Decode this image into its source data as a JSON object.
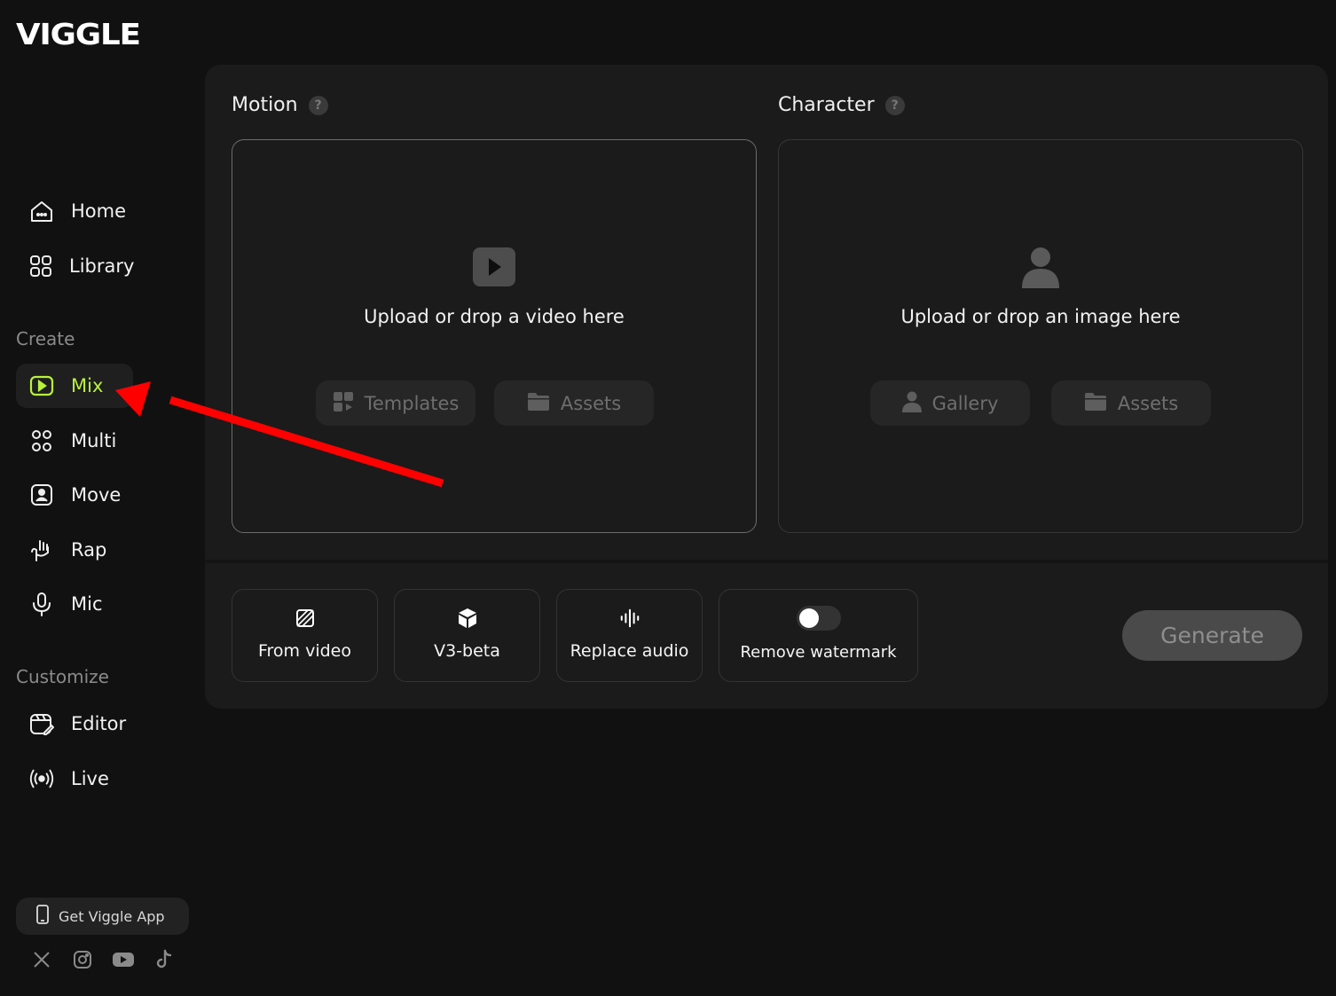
{
  "brand": {
    "logo_text": "VIGGLE"
  },
  "sidebar": {
    "top_items": [
      {
        "label": "Home",
        "icon": "home-icon"
      },
      {
        "label": "Library",
        "icon": "library-icon"
      }
    ],
    "create_label": "Create",
    "create_items": [
      {
        "label": "Mix",
        "icon": "mix-icon",
        "active": true
      },
      {
        "label": "Multi",
        "icon": "multi-icon"
      },
      {
        "label": "Move",
        "icon": "move-icon"
      },
      {
        "label": "Rap",
        "icon": "rap-icon"
      },
      {
        "label": "Mic",
        "icon": "mic-icon"
      }
    ],
    "customize_label": "Customize",
    "customize_items": [
      {
        "label": "Editor",
        "icon": "editor-icon"
      },
      {
        "label": "Live",
        "icon": "live-icon"
      }
    ],
    "get_app_label": "Get Viggle App",
    "socials": [
      "x-icon",
      "instagram-icon",
      "youtube-icon",
      "tiktok-icon"
    ]
  },
  "motion": {
    "title": "Motion",
    "help": "?",
    "drop_text": "Upload or drop a video here",
    "templates_label": "Templates",
    "assets_label": "Assets"
  },
  "character": {
    "title": "Character",
    "help": "?",
    "drop_text": "Upload or drop an image here",
    "gallery_label": "Gallery",
    "assets_label": "Assets"
  },
  "options": {
    "from_video": "From video",
    "model": "V3-beta",
    "replace_audio": "Replace audio",
    "remove_watermark": "Remove watermark",
    "remove_watermark_on": false
  },
  "generate_label": "Generate",
  "colors": {
    "background": "#111111",
    "panel": "#1b1b1b",
    "accent": "#b8f23c",
    "annotation_arrow": "#ff0000"
  }
}
